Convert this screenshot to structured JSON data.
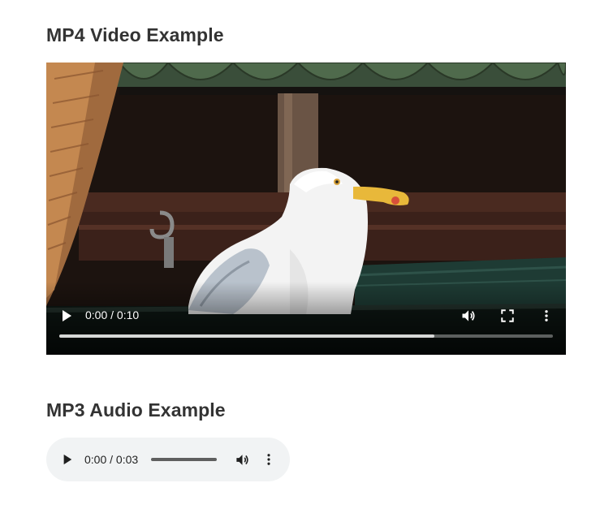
{
  "video_section": {
    "heading": "MP4 Video Example",
    "player": {
      "time_display": "0:00 / 0:10",
      "buffered_fraction": 0.76,
      "controls": {
        "play_icon": "play-icon",
        "volume_icon": "volume-icon",
        "fullscreen_icon": "fullscreen-icon",
        "more_icon": "more-vertical-icon"
      }
    }
  },
  "audio_section": {
    "heading": "MP3 Audio Example",
    "player": {
      "time_display": "0:00 / 0:03",
      "controls": {
        "play_icon": "play-icon",
        "volume_icon": "volume-icon",
        "more_icon": "more-vertical-icon"
      }
    }
  },
  "colors": {
    "heading": "#333333",
    "audio_bg": "#f1f3f4",
    "video_controls": "#ffffff"
  }
}
